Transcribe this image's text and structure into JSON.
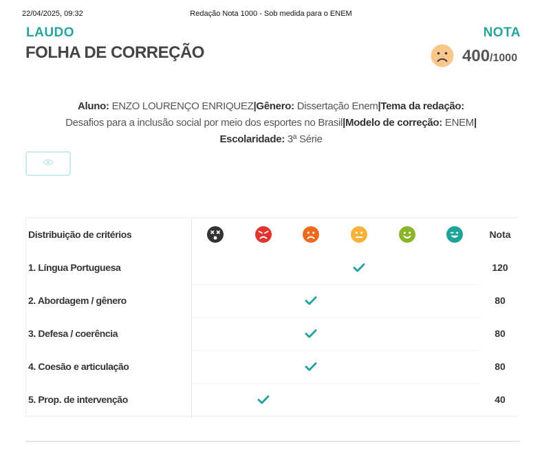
{
  "print_header": {
    "datetime": "22/04/2025, 09:32",
    "title": "Redação Nota 1000 - Sob medida para o ENEM"
  },
  "header": {
    "laudo": "LAUDO",
    "folha": "FOLHA DE CORREÇÃO",
    "nota_label": "NOTA",
    "score": "400",
    "score_max": "/1000",
    "face_icon": "sad-face-icon",
    "face_color": "#fbc689"
  },
  "info": {
    "aluno_label": "Aluno:",
    "aluno": "ENZO LOURENÇO ENRIQUEZ",
    "separator": "|",
    "genero_label": "Gênero:",
    "genero": "Dissertação Enem",
    "tema_label": "Tema da redação:",
    "tema": "Desafios para a inclusão social por meio dos esportes no Brasil",
    "modelo_label": "Modelo de correção:",
    "modelo": "ENEM",
    "escolaridade_label": "Escolaridade:",
    "escolaridade": "3ª Série"
  },
  "eye_button": {
    "icon": "eye-icon"
  },
  "table": {
    "header_label": "Distribuição de critérios",
    "nota_header": "Nota",
    "levels": [
      {
        "icon": "dizzy-face-icon",
        "color": "#333333"
      },
      {
        "icon": "angry-face-icon",
        "color": "#e0342e"
      },
      {
        "icon": "frown-face-icon",
        "color": "#ee6a1e"
      },
      {
        "icon": "neutral-face-icon",
        "color": "#f9b23a"
      },
      {
        "icon": "smile-face-icon",
        "color": "#8ab529"
      },
      {
        "icon": "wink-face-icon",
        "color": "#1ea39a"
      }
    ],
    "check_color": "#27a39e",
    "rows": [
      {
        "label": "1. Língua Portuguesa",
        "level": 3,
        "score": "120"
      },
      {
        "label": "2. Abordagem / gênero",
        "level": 2,
        "score": "80"
      },
      {
        "label": "3. Defesa / coerência",
        "level": 2,
        "score": "80"
      },
      {
        "label": "4. Coesão e articulação",
        "level": 2,
        "score": "80"
      },
      {
        "label": "5. Prop. de intervenção",
        "level": 1,
        "score": "40"
      }
    ]
  }
}
